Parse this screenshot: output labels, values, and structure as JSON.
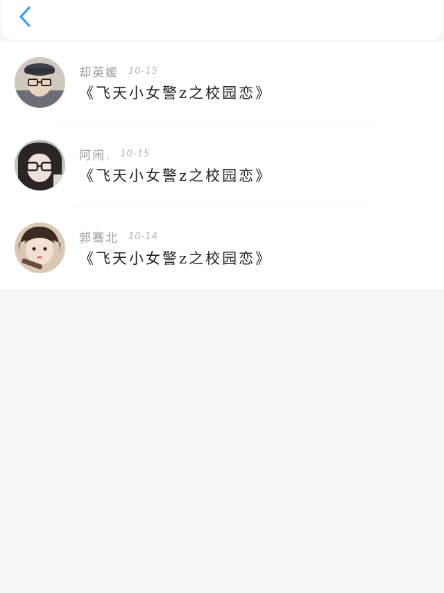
{
  "header": {
    "back_icon": "chevron-left-icon",
    "accent_color": "#3aa0f0"
  },
  "list": {
    "items": [
      {
        "name": "却英媛",
        "time": "10-15",
        "title": "《飞天小女警z之校园恋》"
      },
      {
        "name": "阿闹.",
        "time": "10-15",
        "title": "《飞天小女警z之校园恋》"
      },
      {
        "name": "郭骞北",
        "time": "10-14",
        "title": "《飞天小女警z之校园恋》"
      }
    ]
  }
}
